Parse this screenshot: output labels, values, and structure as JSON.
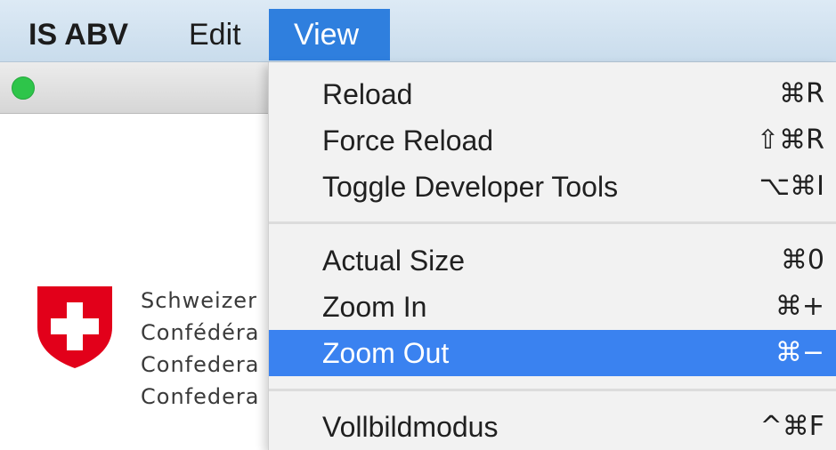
{
  "menubar": {
    "app_name": "IS ABV",
    "edit_label": "Edit",
    "view_label": "View"
  },
  "view_menu": {
    "items": [
      {
        "label": "Reload",
        "shortcut": "⌘R"
      },
      {
        "label": "Force Reload",
        "shortcut": "⇧⌘R"
      },
      {
        "label": "Toggle Developer Tools",
        "shortcut": "⌥⌘I"
      },
      {
        "label": "Actual Size",
        "shortcut": "⌘0"
      },
      {
        "label": "Zoom In",
        "shortcut": "⌘+"
      },
      {
        "label": "Zoom Out",
        "shortcut": "⌘−"
      },
      {
        "label": "Vollbildmodus",
        "shortcut": "^⌘F"
      }
    ],
    "highlighted": "Zoom Out"
  },
  "background": {
    "org_lines": [
      "Schweizer",
      "Confédéra",
      "Confedera",
      "Confedera"
    ]
  },
  "colors": {
    "menubar": "#d3e3f1",
    "selected": "#3a82f0",
    "traffic_light_green": "#2ec54a",
    "swiss_red": "#e2001a"
  },
  "icons": {
    "traffic_light": "green-zoom-light",
    "logo": "swiss-coat-of-arms"
  }
}
